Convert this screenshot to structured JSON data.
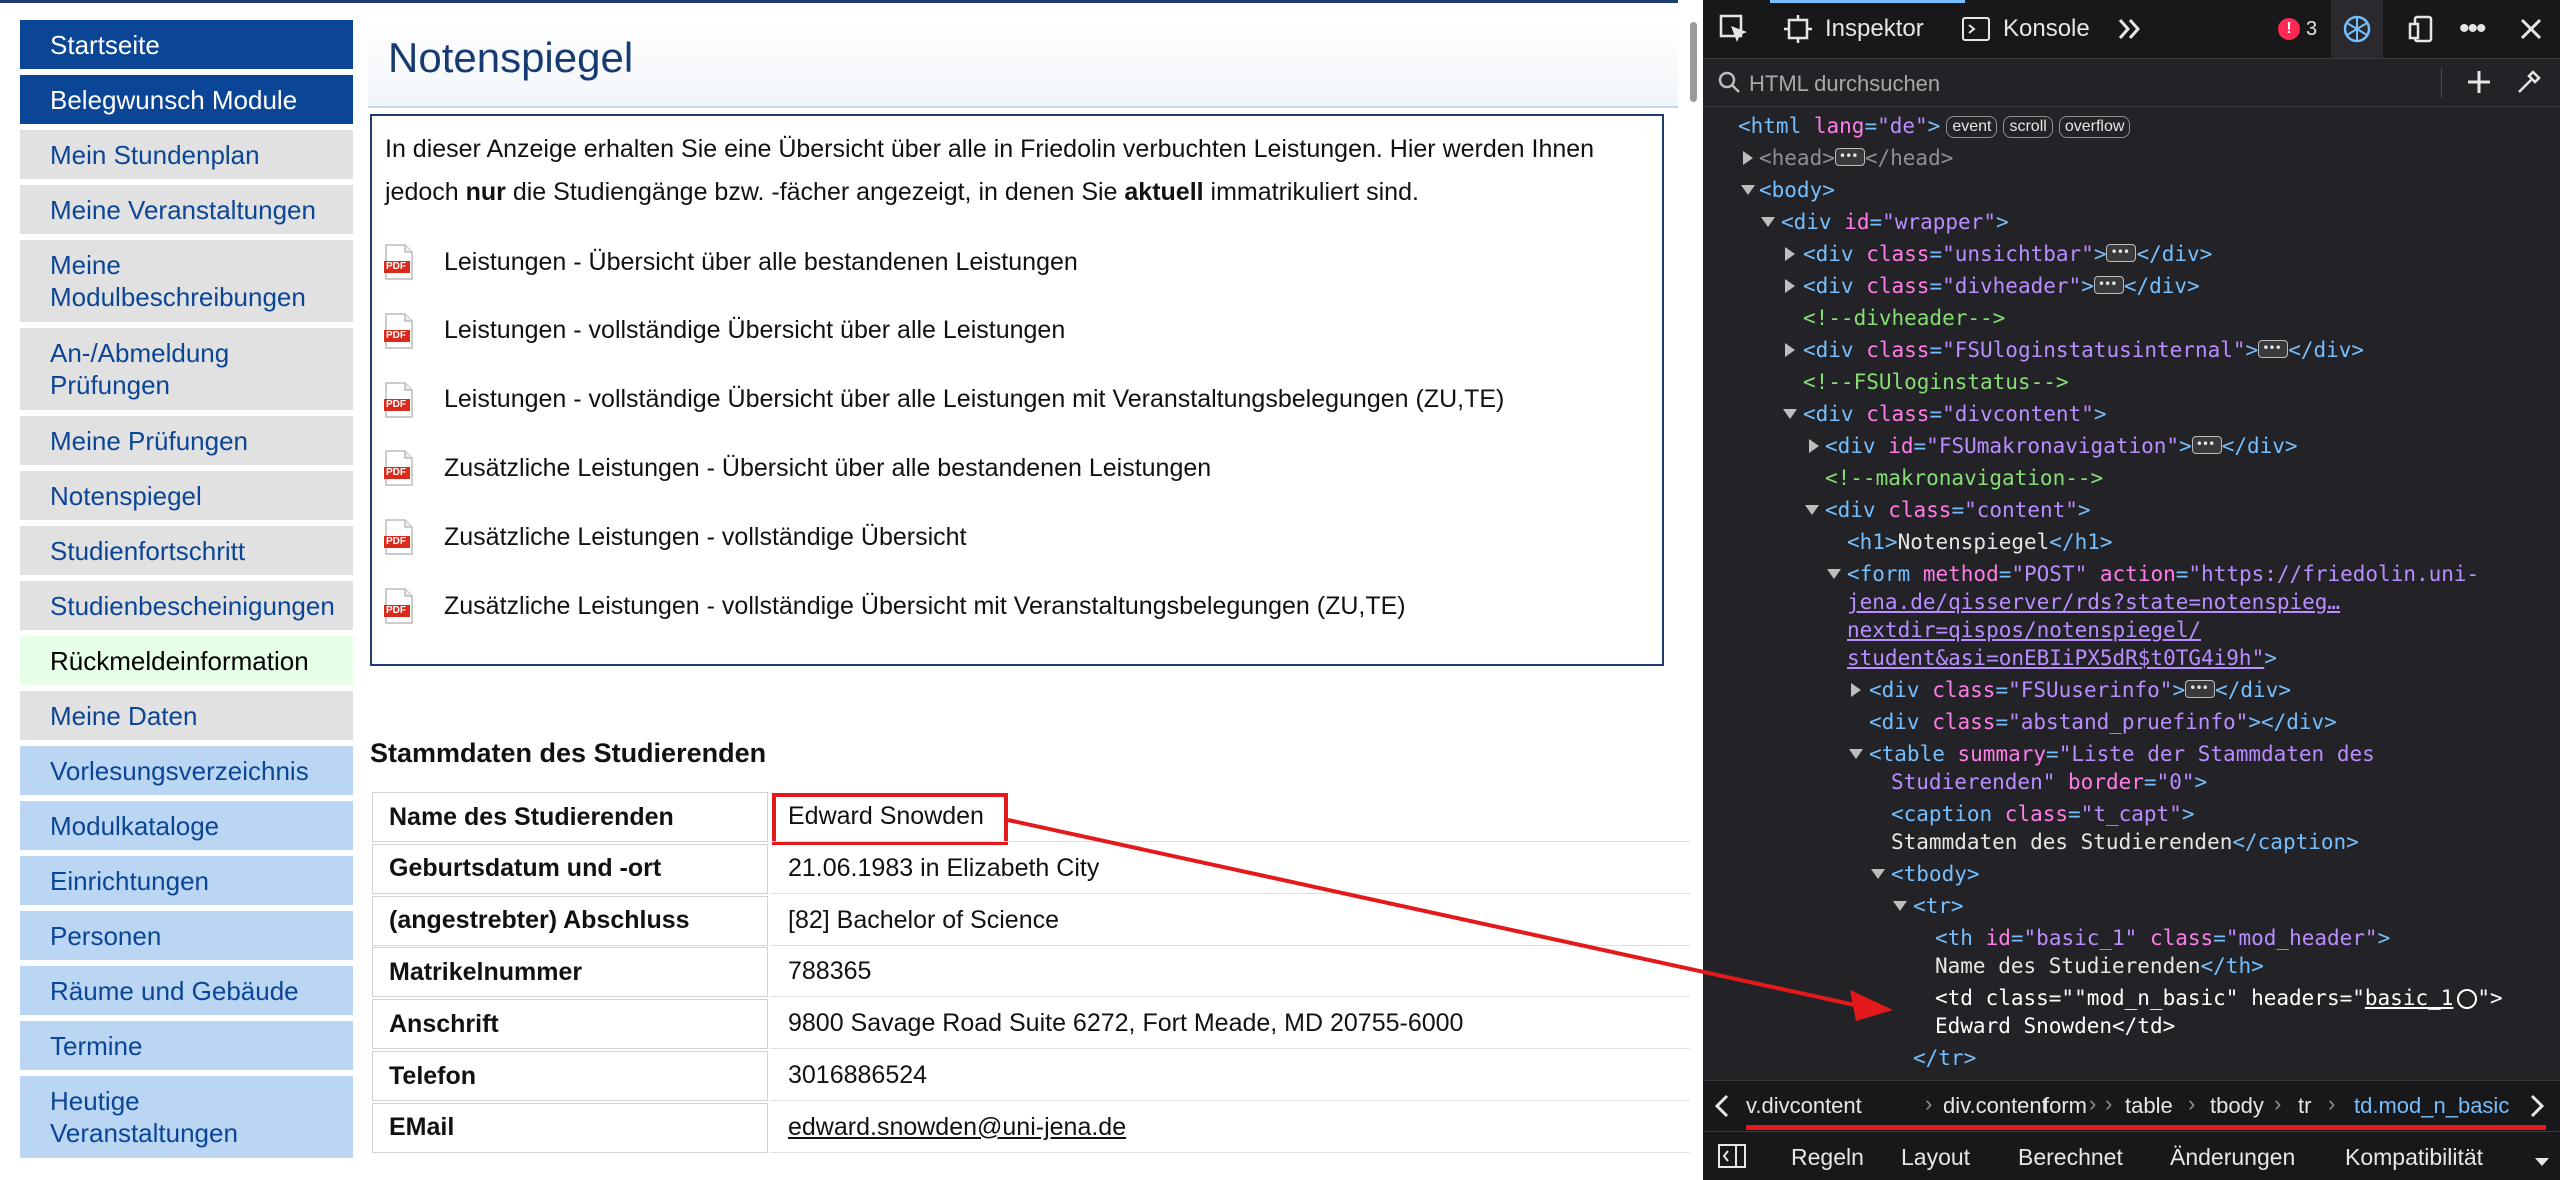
{
  "sidebar": {
    "items": [
      {
        "label": "Startseite",
        "style": "dark"
      },
      {
        "label": "Belegwunsch Module",
        "style": "dark"
      },
      {
        "label": "Mein Stundenplan",
        "style": "grey"
      },
      {
        "label": "Meine Veranstaltungen",
        "style": "grey"
      },
      {
        "label": "Meine\nModulbeschreibungen",
        "style": "grey"
      },
      {
        "label": "An-/Abmeldung\nPrüfungen",
        "style": "grey"
      },
      {
        "label": "Meine Prüfungen",
        "style": "grey"
      },
      {
        "label": "Notenspiegel",
        "style": "grey"
      },
      {
        "label": "Studienfortschritt",
        "style": "grey"
      },
      {
        "label": "Studienbescheinigungen",
        "style": "grey"
      },
      {
        "label": "Rückmeldeinformation",
        "style": "green"
      },
      {
        "label": "Meine Daten",
        "style": "grey"
      },
      {
        "label": "Vorlesungsverzeichnis",
        "style": "blue"
      },
      {
        "label": "Modulkataloge",
        "style": "blue"
      },
      {
        "label": "Einrichtungen",
        "style": "blue"
      },
      {
        "label": "Personen",
        "style": "blue"
      },
      {
        "label": "Räume und Gebäude",
        "style": "blue"
      },
      {
        "label": "Termine",
        "style": "blue"
      },
      {
        "label": "Heutige\nVeranstaltungen",
        "style": "blue"
      }
    ]
  },
  "main": {
    "title": "Notenspiegel",
    "intro_line1": "In dieser Anzeige erhalten Sie eine Übersicht über alle in Friedolin verbuchten Leistungen. Hier werden Ihnen",
    "intro_line2_a": "jedoch ",
    "intro_line2_b": "nur",
    "intro_line2_c": " die Studiengänge bzw. -fächer angezeigt, in denen Sie ",
    "intro_line2_d": "aktuell",
    "intro_line2_e": " immatrikuliert sind.",
    "pdf_icon_text": "PDF",
    "reports": [
      "Leistungen - Übersicht über alle bestandenen Leistungen",
      "Leistungen - vollständige Übersicht über alle Leistungen",
      "Leistungen - vollständige Übersicht über alle Leistungen mit Veranstaltungsbelegungen (ZU,TE)",
      "Zusätzliche Leistungen - Übersicht über alle bestandenen Leistungen",
      "Zusätzliche Leistungen - vollständige Übersicht",
      "Zusätzliche Leistungen - vollständige Übersicht mit Veranstaltungsbelegungen (ZU,TE)"
    ],
    "stamm_caption": "Stammdaten des Studierenden",
    "stamm_rows": [
      {
        "label": "Name des Studierenden",
        "value": "Edward Snowden"
      },
      {
        "label": "Geburtsdatum und -ort",
        "value": "21.06.1983 in Elizabeth City"
      },
      {
        "label": "(angestrebter) Abschluss",
        "value": "[82] Bachelor of Science"
      },
      {
        "label": "Matrikelnummer",
        "value": "788365"
      },
      {
        "label": "Anschrift",
        "value": "9800 Savage Road Suite 6272, Fort Meade, MD 20755-6000"
      },
      {
        "label": "Telefon",
        "value": "3016886524"
      },
      {
        "label": "EMail",
        "value": "edward.snowden@uni-jena.de"
      }
    ]
  },
  "devtools": {
    "tabs": {
      "inspector": "Inspektor",
      "console": "Konsole"
    },
    "error_count": "3",
    "search_placeholder": "HTML durchsuchen",
    "tree": {
      "html_lang": "\"de\"",
      "badges": [
        "event",
        "scroll",
        "overflow"
      ],
      "l_wrapper_id": "\"wrapper\"",
      "l_unsichtbar": "\"unsichtbar\"",
      "l_divheader": "\"divheader\"",
      "c_divheader": "<!--divheader-->",
      "l_loginstatus": "\"FSUloginstatusinternal\"",
      "c_loginstatus": "<!--FSUloginstatus-->",
      "l_divcontent": "\"divcontent\"",
      "l_makro": "\"FSUmakronavigation\"",
      "c_makro": "<!--makronavigation-->",
      "l_content": "\"content\"",
      "h1_text": "Notenspiegel",
      "form_method": "\"POST\"",
      "form_action_1": "\"https://friedolin.uni-",
      "form_action_2": "jena.de/qisserver/rds?state=notenspieg…",
      "form_action_3": "nextdir=qispos/notenspiegel/",
      "form_action_4": "student&asi=onEBIiPX5dR$t0TG4i9h\"",
      "l_userinfo": "\"FSUuserinfo\"",
      "l_abstand": "\"abstand_pruefinfo\"",
      "table_summary_1": "\"Liste der Stammdaten des",
      "table_summary_2": "Studierenden\"",
      "table_border": "\"0\"",
      "caption_class": "\"t_capt\"",
      "caption_text": "Stammdaten des Studierenden",
      "th_id": "\"basic_1\"",
      "th_class": "\"mod_header\"",
      "th_text": "Name des Studierenden",
      "td_class": "\"mod_n_basic\"",
      "td_headers": "basic_1",
      "td_text": "Edward Snowden"
    },
    "breadcrumbs": [
      "v.divcontent",
      "div.content",
      "form",
      "table",
      "tbody",
      "tr",
      "td.mod_n_basic"
    ],
    "bottom_tabs": [
      "Regeln",
      "Layout",
      "Berechnet",
      "Änderungen",
      "Kompatibilität"
    ]
  },
  "colors": {
    "nav_dark": "#0b4595",
    "nav_grey": "#e1e1e1",
    "nav_blue": "#bad6f2",
    "nav_green": "#e6ffe6",
    "highlight_red": "#e3191b",
    "devtools_bg": "#232327",
    "selected_row": "#204e8a"
  }
}
